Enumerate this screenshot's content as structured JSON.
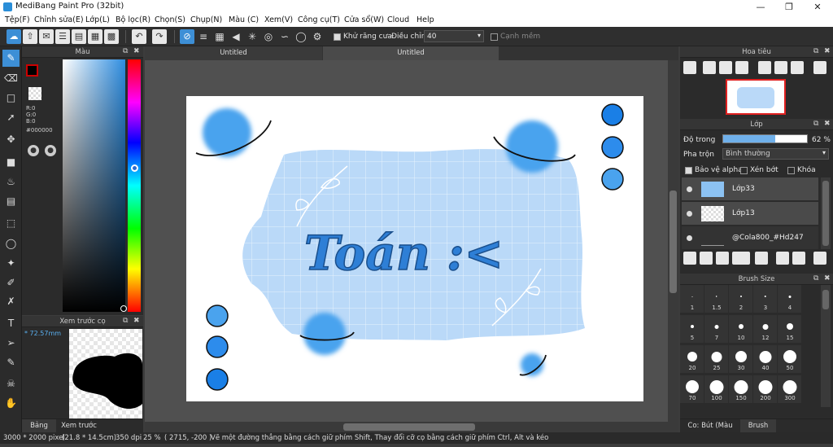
{
  "app": {
    "title": "MediBang Paint Pro (32bit)"
  },
  "menu": [
    "Tệp(F)",
    "Chỉnh sửa(E)",
    "Lớp(L)",
    "Bộ lọc(R)",
    "Chọn(S)",
    "Chụp(N)",
    "Màu (C)",
    "Xem(V)",
    "Công cụ(T)",
    "Cửa sổ(W)",
    "Cloud",
    "Help"
  ],
  "toolbar": {
    "antialias_label": "Khử răng cưa",
    "adjust_label": "Điều chỉnh",
    "adjust_value": "40",
    "edge_label": "Cạnh mềm"
  },
  "tabs": [
    "Untitled",
    "Untitled"
  ],
  "color_panel": {
    "title": "Màu",
    "r": "R:0",
    "g": "G:0",
    "b": "B:0",
    "hex": "#000000"
  },
  "brush_preview": {
    "title": "Xem trước cọ",
    "size": "* 72.57mm",
    "tabs": [
      "Bảng màu",
      "Xem trước cọ"
    ]
  },
  "navigator": {
    "title": "Hoa tiêu"
  },
  "layer_panel": {
    "title": "Lớp",
    "opacity_label": "Độ trong",
    "opacity_value": "62 %",
    "opacity_fraction": 0.62,
    "blend_label": "Pha trộn",
    "blend_value": "Bình thường",
    "protect_alpha": "Bảo vệ alpha",
    "clipping": "Xén bớt",
    "lock": "Khóa",
    "layers": [
      "Lớp33",
      "Lớp13",
      "@Cola800_#Hd247"
    ]
  },
  "brush_size": {
    "title": "Brush Size",
    "sizes": [
      "1",
      "1.5",
      "2",
      "3",
      "4",
      "5",
      "7",
      "10",
      "12",
      "15",
      "20",
      "25",
      "30",
      "40",
      "50",
      "70",
      "100",
      "150",
      "200",
      "300"
    ],
    "footer_tabs": [
      "Co: Bút (Màu sáp)",
      "Brush Size"
    ]
  },
  "canvas_text": "Toán :<",
  "status": {
    "size": "3000 * 2000 pixel",
    "cm": "(21.8 * 14.5cm)",
    "dpi": "350 dpi",
    "zoom": "25 %",
    "coords": "( 2715, -200 )",
    "hint": "Vẽ một đường thẳng bằng cách giữ phím Shift, Thay đổi cỡ cọ bằng cách giữ phím Ctrl, Alt và kéo"
  },
  "colors": {
    "accent": "#3d8fd6",
    "paint_blue": "#3e9ff0",
    "paper": "#ffffff"
  }
}
